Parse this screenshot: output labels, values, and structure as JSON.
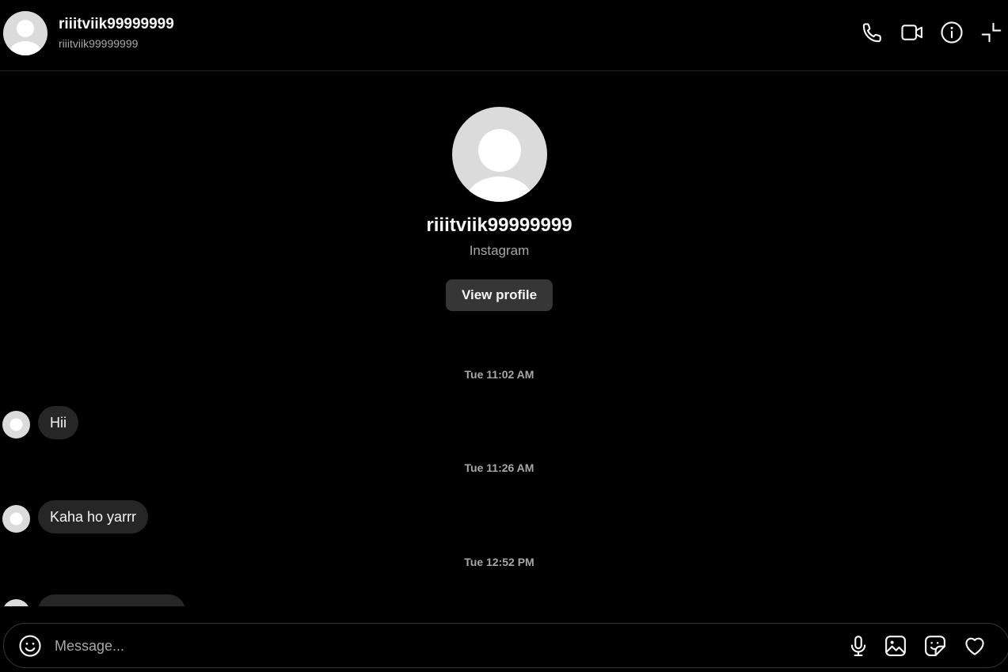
{
  "header": {
    "display_name": "riiitviik99999999",
    "username": "riiitviik99999999",
    "icons": [
      "phone-icon",
      "video-camera-icon",
      "info-icon",
      "minimize-icon"
    ]
  },
  "profile": {
    "display_name": "riiitviik99999999",
    "source": "Instagram",
    "view_profile_label": "View profile"
  },
  "conversation": {
    "timestamps": [
      "Tue 11:02 AM",
      "Tue 11:26 AM",
      "Tue 12:52 PM"
    ],
    "messages": [
      "Hii",
      "Kaha ho yarrr"
    ]
  },
  "composer": {
    "placeholder": "Message...",
    "icons": [
      "emoji-icon",
      "microphone-icon",
      "image-icon",
      "sticker-icon",
      "heart-icon"
    ]
  },
  "colors": {
    "background": "#000000",
    "bubble": "#262626",
    "button": "#363636",
    "secondary_text": "#a8a8a8",
    "avatar_placeholder": "#dbdbdb"
  }
}
